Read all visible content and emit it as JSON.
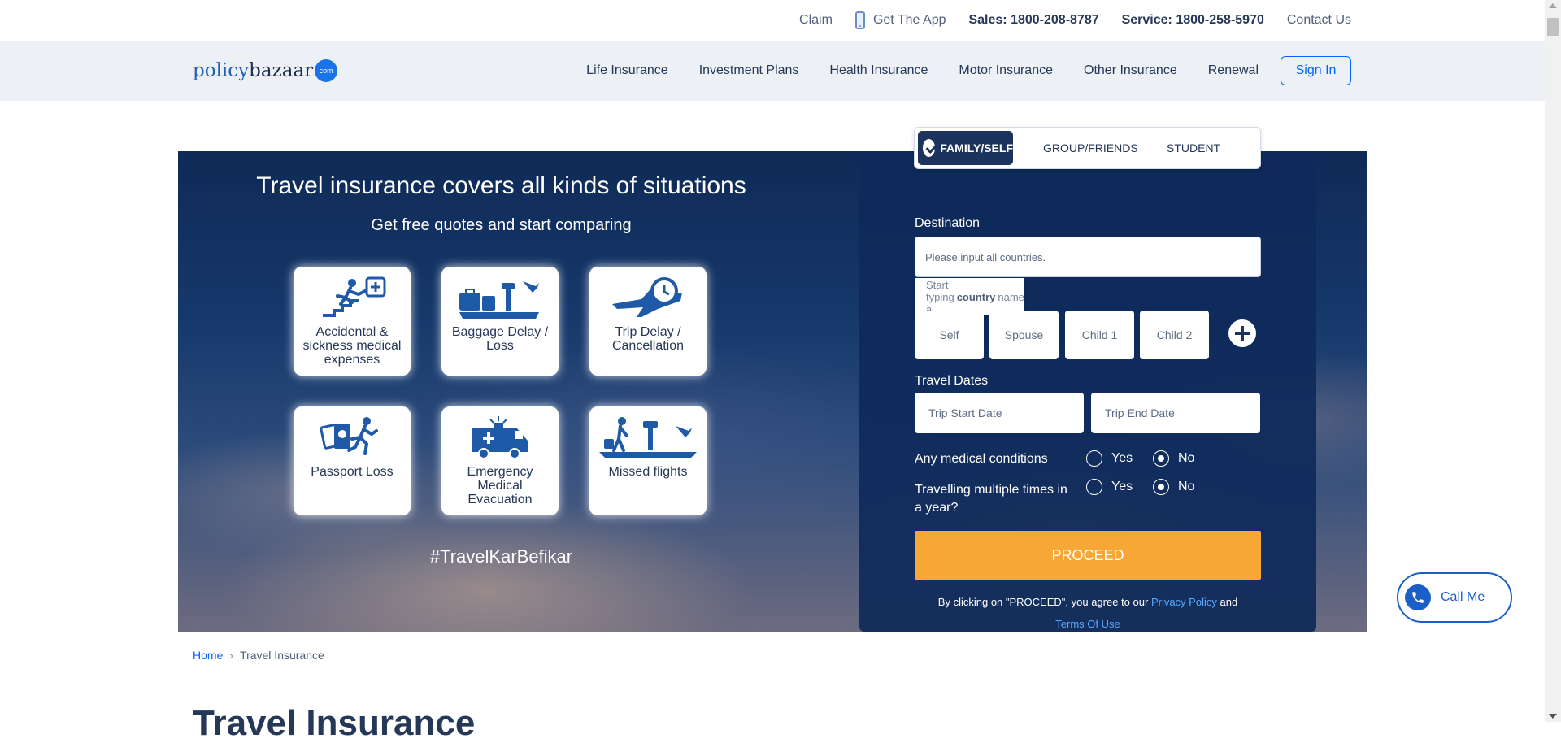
{
  "topbar": {
    "claim": "Claim",
    "get_app": "Get The App",
    "sales": "Sales: 1800-208-8787",
    "service": "Service: 1800-258-5970",
    "contact": "Contact Us"
  },
  "header": {
    "logo_part1": "policy",
    "logo_part2": "bazaar",
    "logo_badge": "com",
    "nav": [
      "Life Insurance",
      "Investment Plans",
      "Health Insurance",
      "Motor Insurance",
      "Other Insurance",
      "Renewal"
    ],
    "sign_in": "Sign In"
  },
  "hero": {
    "title": "Travel insurance covers all kinds of situations",
    "subtitle": "Get free quotes and start comparing",
    "tiles": [
      {
        "label": "Accidental & sickness medical expenses",
        "icon": "accident-icon"
      },
      {
        "label": "Baggage Delay / Loss",
        "icon": "baggage-icon"
      },
      {
        "label": "Trip Delay / Cancellation",
        "icon": "trip-delay-icon"
      },
      {
        "label": "Passport Loss",
        "icon": "passport-icon"
      },
      {
        "label": "Emergency Medical Evacuation",
        "icon": "ambulance-icon"
      },
      {
        "label": "Missed flights",
        "icon": "missed-flight-icon"
      }
    ],
    "hashtag": "#TravelKarBefikar"
  },
  "form": {
    "tabs": [
      "FAMILY/SELF",
      "GROUP/FRIENDS",
      "STUDENT"
    ],
    "active_tab": "FAMILY/SELF",
    "destination_label": "Destination",
    "destination_placeholder": "Please input all countries.",
    "destination_hint_pre": "Start typing a",
    "destination_hint_bold": "country",
    "destination_hint_post": "name",
    "members": [
      "Self",
      "Spouse",
      "Child 1",
      "Child 2"
    ],
    "travel_dates_label": "Travel Dates",
    "trip_start": "Trip Start Date",
    "trip_end": "Trip End Date",
    "medical_label": "Any medical conditions",
    "multi_trip_label": "Travelling multiple times in a year?",
    "yes": "Yes",
    "no": "No",
    "medical_value": "No",
    "multi_trip_value": "No",
    "proceed": "PROCEED",
    "terms_pre": "By clicking on \"PROCEED\", you agree to our",
    "privacy": "Privacy Policy",
    "and": "and",
    "terms_of_use": "Terms Of Use",
    "colors": {
      "proceed": "#f6a735",
      "panel": "#0e2a5a",
      "link": "#59a7ff"
    }
  },
  "callme": {
    "label": "Call Me"
  },
  "breadcrumb": {
    "home": "Home",
    "current": "Travel Insurance"
  },
  "page": {
    "heading": "Travel Insurance"
  }
}
